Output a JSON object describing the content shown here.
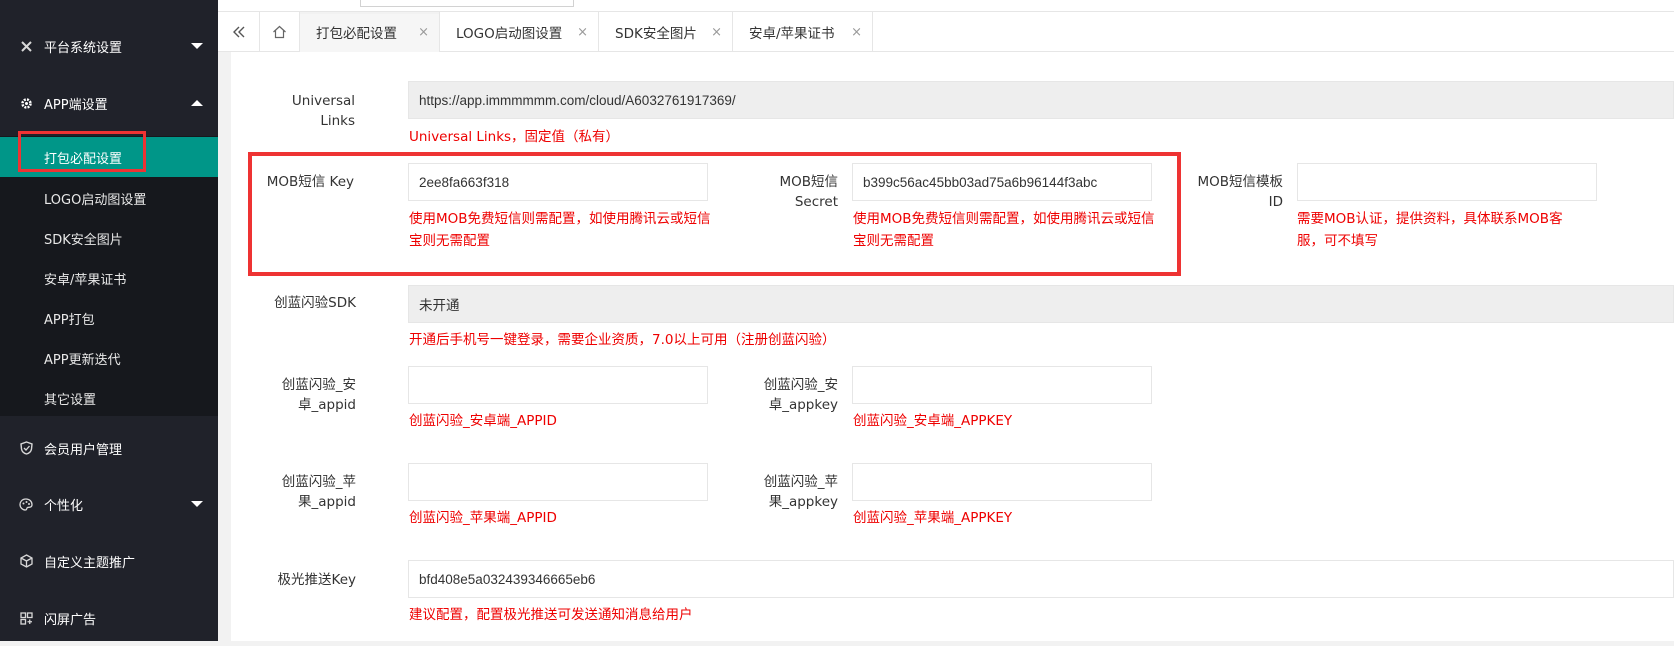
{
  "sidebar": {
    "groups": [
      {
        "icon": "tools-icon",
        "label": "平台系统设置"
      },
      {
        "icon": "gear-icon",
        "label": "APP端设置"
      },
      {
        "icon": "shield-icon",
        "label": "会员用户管理"
      },
      {
        "icon": "palette-icon",
        "label": "个性化"
      },
      {
        "icon": "cube-icon",
        "label": "自定义主题推广"
      },
      {
        "icon": "grid-icon",
        "label": "闪屏广告"
      }
    ],
    "app_submenu": [
      "打包必配设置",
      "LOGO启动图设置",
      "SDK安全图片",
      "安卓/苹果证书",
      "APP打包",
      "APP更新迭代",
      "其它设置"
    ]
  },
  "tabbar": {
    "collapse_icon": "double-chevron-left-icon",
    "home_icon": "home-icon",
    "close_glyph": "×",
    "tabs": [
      "打包必配设置",
      "LOGO启动图设置",
      "SDK安全图片",
      "安卓/苹果证书"
    ]
  },
  "form": {
    "universal_links": {
      "label": "Universal Links",
      "value": "https://app.immmmmm.com/cloud/A6032761917369/",
      "hint": "Universal Links，固定值（私有）"
    },
    "mob_key": {
      "label": "MOB短信 Key",
      "value": "2ee8fa663f318",
      "hint": "使用MOB免费短信则需配置，如使用腾讯云或短信宝则无需配置"
    },
    "mob_secret": {
      "label": "MOB短信 Secret",
      "value": "b399c56ac45bb03ad75a6b96144f3abc",
      "hint": "使用MOB免费短信则需配置，如使用腾讯云或短信宝则无需配置"
    },
    "mob_template": {
      "label": "MOB短信模板 ID",
      "value": "",
      "hint": "需要MOB认证，提供资料，具体联系MOB客服，可不填写"
    },
    "cl_sdk": {
      "label": "创蓝闪验SDK",
      "value": "未开通",
      "hint": "开通后手机号一键登录，需要企业资质，7.0以上可用（注册创蓝闪验）"
    },
    "cl_android_appid": {
      "label": "创蓝闪验_安卓_appid",
      "value": "",
      "hint": "创蓝闪验_安卓端_APPID"
    },
    "cl_android_appkey": {
      "label": "创蓝闪验_安卓_appkey",
      "value": "",
      "hint": "创蓝闪验_安卓端_APPKEY"
    },
    "cl_ios_appid": {
      "label": "创蓝闪验_苹果_appid",
      "value": "",
      "hint": "创蓝闪验_苹果端_APPID"
    },
    "cl_ios_appkey": {
      "label": "创蓝闪验_苹果_appkey",
      "value": "",
      "hint": "创蓝闪验_苹果端_APPKEY"
    },
    "jpush_key": {
      "label": "极光推送Key",
      "value": "bfd408e5a032439346665eb6",
      "hint": "建议配置，配置极光推送可发送通知消息给用户"
    }
  },
  "colors": {
    "sidebar_bg": "#20222a",
    "active_bg": "#009688",
    "hint": "#ee0000",
    "highlight_box": "#ee3333"
  }
}
